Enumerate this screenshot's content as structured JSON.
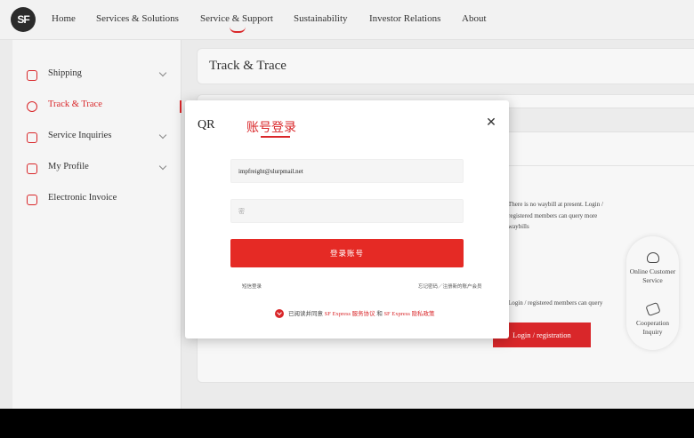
{
  "header": {
    "logo_text": "SF",
    "nav": [
      "Home",
      "Services & Solutions",
      "Service & Support",
      "Sustainability",
      "Investor Relations",
      "About"
    ],
    "active_nav": "Service & Support"
  },
  "sidebar": {
    "items": [
      {
        "label": "Shipping",
        "icon": "send-icon",
        "has_chevron": true
      },
      {
        "label": "Track & Trace",
        "icon": "search-icon",
        "active": true
      },
      {
        "label": "Service Inquiries",
        "icon": "inquiry-icon",
        "has_chevron": true
      },
      {
        "label": "My Profile",
        "icon": "profile-icon",
        "has_chevron": true
      },
      {
        "label": "Electronic Invoice",
        "icon": "invoice-icon"
      }
    ]
  },
  "main": {
    "page_title": "Track & Trace",
    "no_waybill_text": "There is no waybill at present. Login / registered members can query more waybills",
    "login_note": "Login / registered members can query",
    "login_button": "Login / registration"
  },
  "float_panel": {
    "items": [
      {
        "label": "Online Customer Service",
        "icon": "headset-icon"
      },
      {
        "label": "Cooperation Inquiry",
        "icon": "handshake-icon"
      }
    ]
  },
  "modal": {
    "tab_qr": "QR",
    "tab_login": "账号登录",
    "email_value": "impfreight@slurpmail.net",
    "password_placeholder": "密",
    "submit_label": "登录账号",
    "link_left": "短信登录",
    "link_right": "忘记密码／注册新的账户会员",
    "agree_prefix": "已阅读并同意",
    "agree_link1": "SF Express 服务协议",
    "agree_and": "和",
    "agree_link2": "SF Express 隐私政策",
    "close_icon": "close-icon"
  },
  "colors": {
    "brand_red": "#d9272a",
    "logo_dark": "#2b2b2b"
  }
}
